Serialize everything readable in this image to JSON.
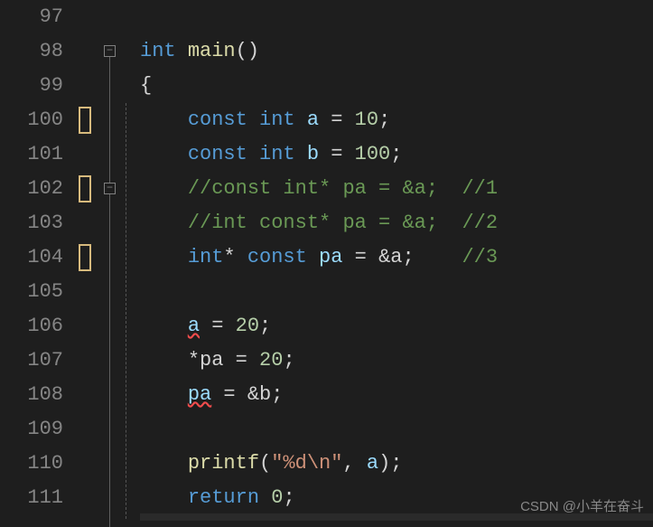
{
  "lines": {
    "l97": "97",
    "l98": "98",
    "l99": "99",
    "l100": "100",
    "l101": "101",
    "l102": "102",
    "l103": "103",
    "l104": "104",
    "l105": "105",
    "l106": "106",
    "l107": "107",
    "l108": "108",
    "l109": "109",
    "l110": "110",
    "l111": "111"
  },
  "code": {
    "int": "int",
    "main": "main",
    "lpar": "(",
    "rpar": ")",
    "lbrace": "{",
    "const": "const",
    "a": "a",
    "b": "b",
    "eq": " = ",
    "v10": "10",
    "v100": "100",
    "semi": ";",
    "star": "*",
    "pa": "pa",
    "amp_a": "&a",
    "amp_b": "&b",
    "cmt1": "//const int* pa = &a;  //1",
    "cmt2": "//int const* pa = &a;  //2",
    "cmt3": "//3",
    "v20": "20",
    "printf": "printf",
    "fmtstr": "\"%d\\n\"",
    "comma": ", ",
    "return": "return",
    "zero": "0",
    "sp1": " ",
    "sp2": "  ",
    "sp4": "    ",
    "spgap": "    ",
    "starpa": "*pa"
  },
  "watermark": "CSDN @小羊在奋斗",
  "fold_minus": "−"
}
